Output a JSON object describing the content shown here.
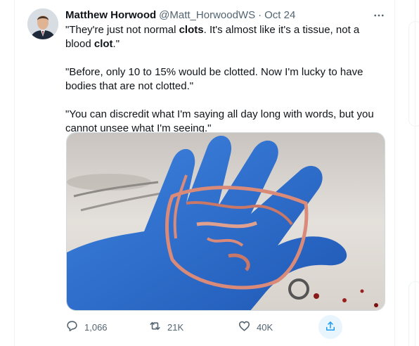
{
  "tweet": {
    "author_name": "Matthew Horwood",
    "author_handle": "@Matt_HorwoodWS",
    "separator": "·",
    "date": "Oct 24",
    "paragraphs": [
      [
        {
          "text": "\"They're just not normal ",
          "bold": false
        },
        {
          "text": "clots",
          "bold": true
        },
        {
          "text": ". It's almost like it's a tissue, not a blood ",
          "bold": false
        },
        {
          "text": "clot",
          "bold": true
        },
        {
          "text": ".\"",
          "bold": false
        }
      ],
      [
        {
          "text": "\"Before, only 10 to 15% would be clotted. Now I'm lucky to have bodies that are not clotted.\"",
          "bold": false
        }
      ],
      [
        {
          "text": "\"You can discredit what I'm saying all day long with words, but you cannot unsee what I'm seeing.\"",
          "bold": false
        }
      ]
    ]
  },
  "actions": {
    "reply_count": "1,066",
    "retweet_count": "21K",
    "like_count": "40K"
  },
  "icons": {
    "more": "more-horizontal-icon",
    "reply": "reply-icon",
    "retweet": "retweet-icon",
    "like": "heart-icon",
    "share": "share-icon"
  },
  "colors": {
    "text": "#0f1419",
    "secondary": "#536471",
    "accent": "#1d9bf0",
    "glove": "#2f6fd0",
    "tissue": "#d98a78"
  }
}
